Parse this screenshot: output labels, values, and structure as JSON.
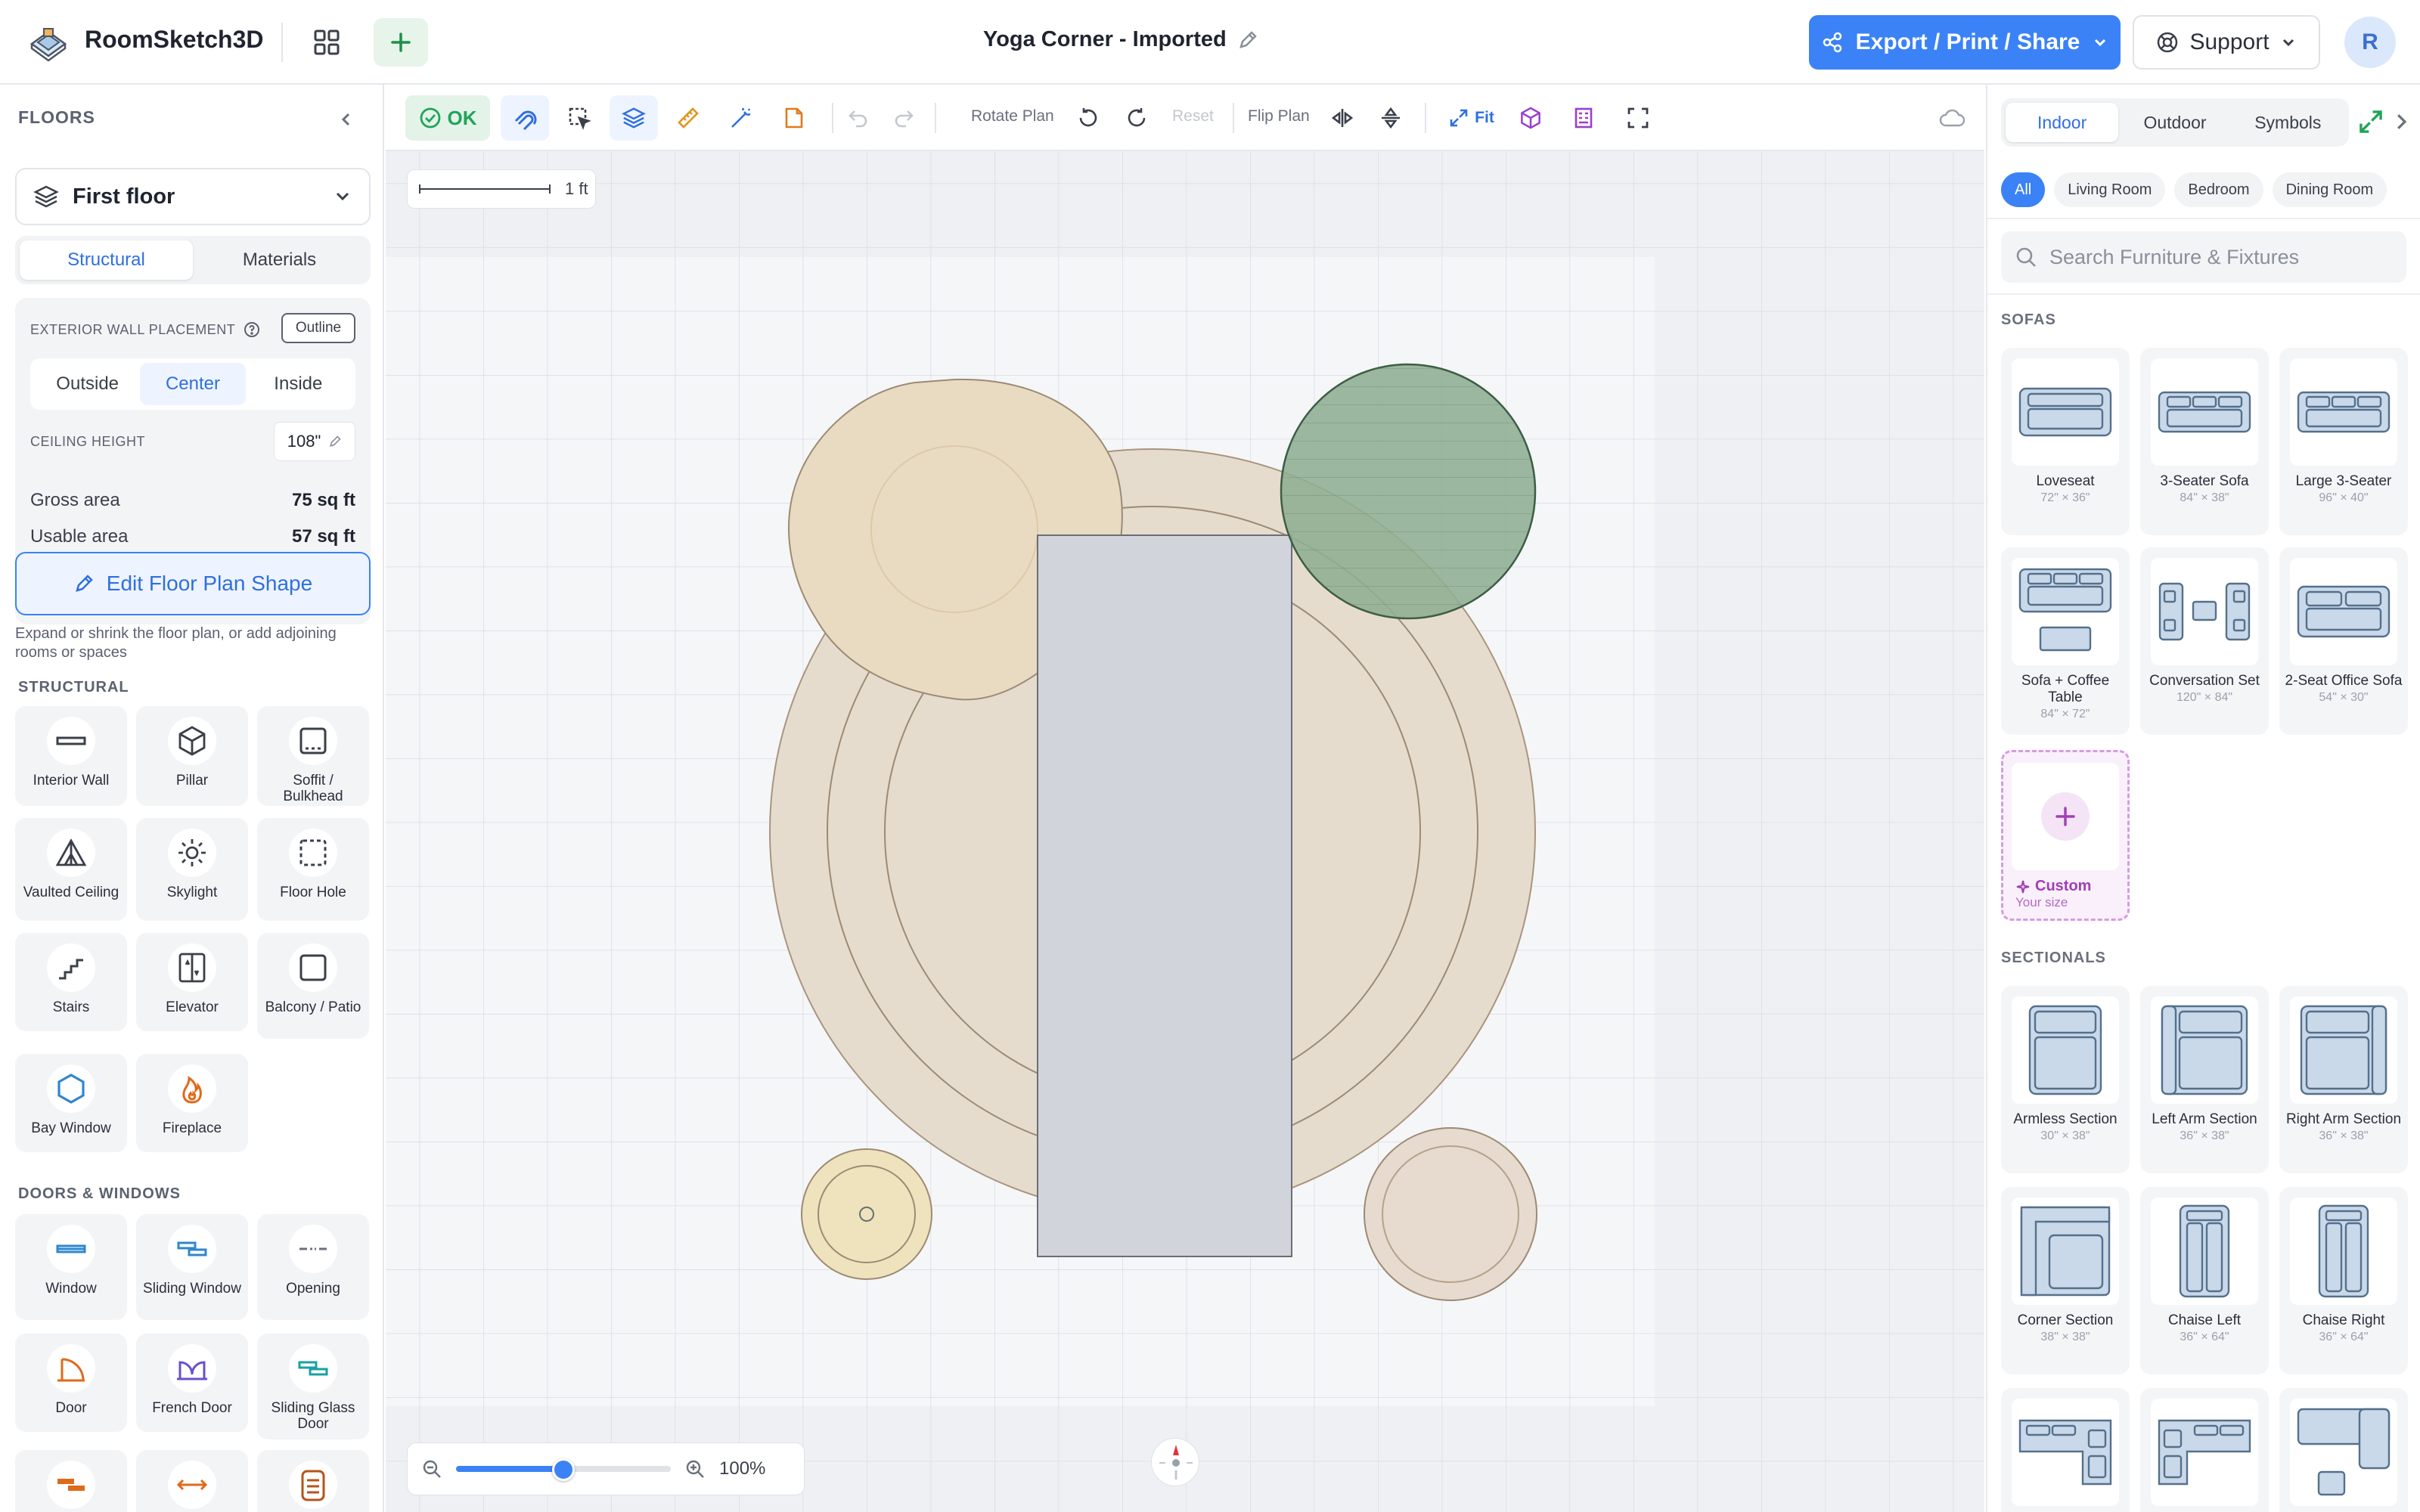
{
  "header": {
    "app_name": "RoomSketch3D",
    "doc_title": "Yoga Corner - Imported",
    "export_label": "Export / Print / Share",
    "support_label": "Support",
    "avatar_initial": "R"
  },
  "left": {
    "heading": "FLOORS",
    "floor_name": "First floor",
    "tabs": [
      "Structural",
      "Materials"
    ],
    "wall_placement_label": "EXTERIOR WALL PLACEMENT",
    "outline_label": "Outline",
    "placement_options": [
      "Outside",
      "Center",
      "Inside"
    ],
    "ceiling_label": "CEILING HEIGHT",
    "ceiling_value": "108\"",
    "gross_label": "Gross area",
    "gross_value": "75 sq ft",
    "usable_label": "Usable area",
    "usable_value": "57 sq ft",
    "edit_label": "Edit Floor Plan Shape",
    "edit_desc": "Expand or shrink the floor plan, or add adjoining rooms or spaces",
    "structural_heading": "STRUCTURAL",
    "structural_items": [
      "Interior Wall",
      "Pillar",
      "Soffit / Bulkhead",
      "Vaulted Ceiling",
      "Skylight",
      "Floor Hole",
      "Stairs",
      "Elevator",
      "Balcony / Patio",
      "Bay Window",
      "Fireplace"
    ],
    "doors_heading": "DOORS & WINDOWS",
    "doors_items": [
      "Window",
      "Sliding Window",
      "Opening",
      "Door",
      "French Door",
      "Sliding Glass Door"
    ]
  },
  "toolbar": {
    "ok_label": "OK",
    "rotate_label": "Rotate Plan",
    "reset_label": "Reset",
    "flip_label": "Flip Plan",
    "fit_label": "Fit"
  },
  "canvas": {
    "scale_label": "1 ft",
    "zoom_label": "100%",
    "zoom_fraction": 0.5
  },
  "right": {
    "tabs": [
      "Indoor",
      "Outdoor",
      "Symbols"
    ],
    "chips": [
      "All",
      "Living Room",
      "Bedroom",
      "Dining Room"
    ],
    "search_placeholder": "Search Furniture & Fixtures",
    "sofas_heading": "SOFAS",
    "sofas": [
      {
        "name": "Loveseat",
        "dims": "72\" × 36\""
      },
      {
        "name": "3-Seater Sofa",
        "dims": "84\" × 38\""
      },
      {
        "name": "Large 3-Seater",
        "dims": "96\" × 40\""
      },
      {
        "name": "Sofa + Coffee Table",
        "dims": "84\" × 72\""
      },
      {
        "name": "Conversation Set",
        "dims": "120\" × 84\""
      },
      {
        "name": "2-Seat Office Sofa",
        "dims": "54\" × 30\""
      }
    ],
    "custom_name": "Custom",
    "custom_sub": "Your size",
    "sectionals_heading": "SECTIONALS",
    "sectionals": [
      {
        "name": "Armless Section",
        "dims": "30\" × 38\""
      },
      {
        "name": "Left Arm Section",
        "dims": "36\" × 38\""
      },
      {
        "name": "Right Arm Section",
        "dims": "36\" × 38\""
      },
      {
        "name": "Corner Section",
        "dims": "38\" × 38\""
      },
      {
        "name": "Chaise Left",
        "dims": "36\" × 64\""
      },
      {
        "name": "Chaise Right",
        "dims": "36\" × 64\""
      }
    ]
  },
  "colors": {
    "accent": "#3b82f6",
    "ok_green": "#22a35a",
    "rug": "#e6dccd",
    "ottoman": "#e8dac0",
    "green_cushion": "#8fae92",
    "mat": "#d2d4db"
  },
  "icons": [
    "logo-icon",
    "grid-icon",
    "plus-icon",
    "pencil-icon",
    "share-icon",
    "lifebuoy-icon",
    "layers-icon",
    "chevron-down-icon",
    "help-icon",
    "search-icon",
    "cloud-icon",
    "expand-icon",
    "compass-icon",
    "zoom-out-icon",
    "zoom-in-icon"
  ]
}
